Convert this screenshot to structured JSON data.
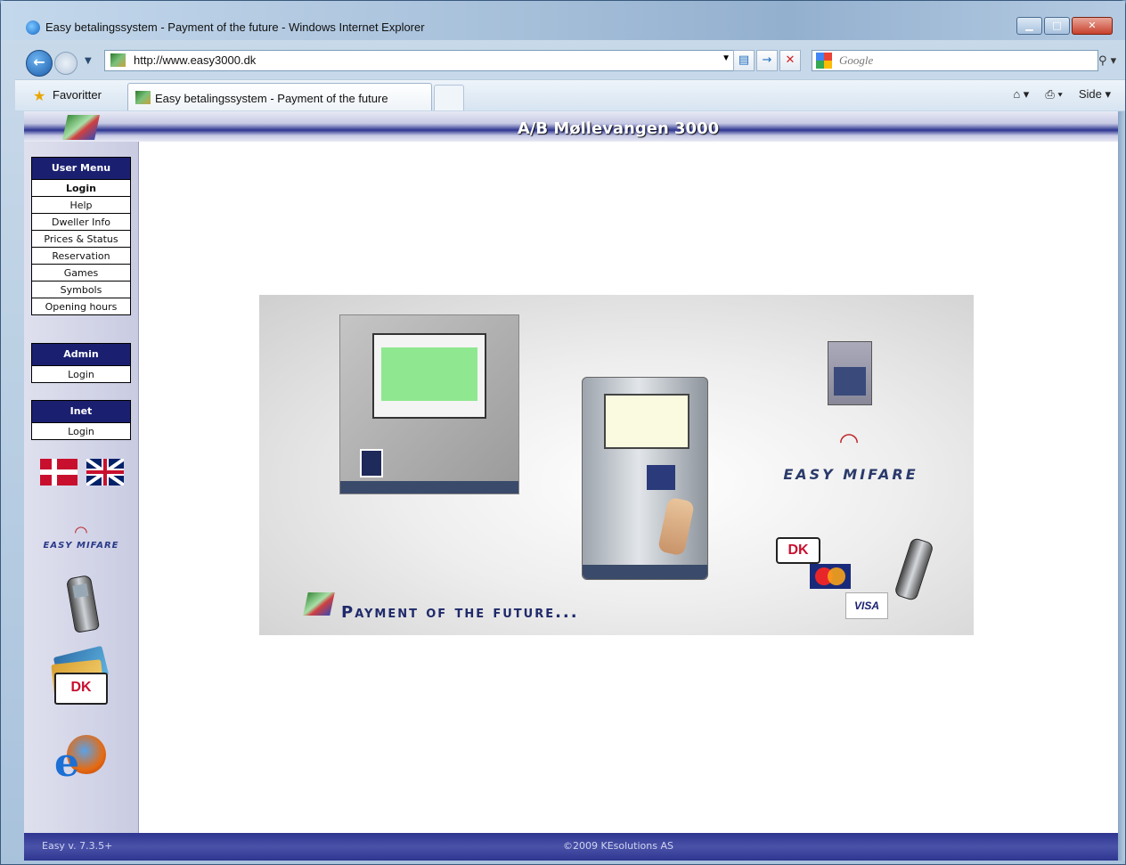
{
  "window": {
    "title": "Easy betalingssystem - Payment of the future - Windows Internet Explorer",
    "minimize_glyph": "▁",
    "maximize_glyph": "□",
    "close_glyph": "✕"
  },
  "address_bar": {
    "url": "http://www.easy3000.dk",
    "search_placeholder": "Google"
  },
  "favorites_bar": {
    "favorites_label": "Favoritter",
    "tab_title": "Easy betalingssystem - Payment of the future",
    "page_menu_label": "Side"
  },
  "page": {
    "header_title": "A/B Møllevangen 3000",
    "user_menu": {
      "title": "User Menu",
      "items": [
        "Login",
        "Help",
        "Dweller Info",
        "Prices & Status",
        "Reservation",
        "Games",
        "Symbols",
        "Opening hours"
      ]
    },
    "admin_menu": {
      "title": "Admin",
      "items": [
        "Login"
      ]
    },
    "inet_menu": {
      "title": "Inet",
      "items": [
        "Login"
      ]
    },
    "sidebar_mifare": "EASY MIFARE",
    "dk_card_label": "DK",
    "banner": {
      "mifare_text": "EASY MIFARE",
      "dk_logo": "DK",
      "visa_logo": "VISA",
      "tagline": "Payment of the future..."
    },
    "footer": {
      "version": "Easy v. 7.3.5+",
      "copyright": "©2009 KEsolutions AS"
    }
  },
  "icons": [
    "ie-icon",
    "back-icon",
    "forward-icon",
    "refresh-icon",
    "stop-icon",
    "search-icon",
    "star-icon",
    "home-icon",
    "print-icon",
    "danish-flag-icon",
    "uk-flag-icon",
    "wifi-icon",
    "phone-icon",
    "cards-icon",
    "browser-logos-icon"
  ],
  "colors": {
    "menu_header": "#1a1f70",
    "header_band": "#2d3590",
    "dk_red": "#c8102e"
  }
}
